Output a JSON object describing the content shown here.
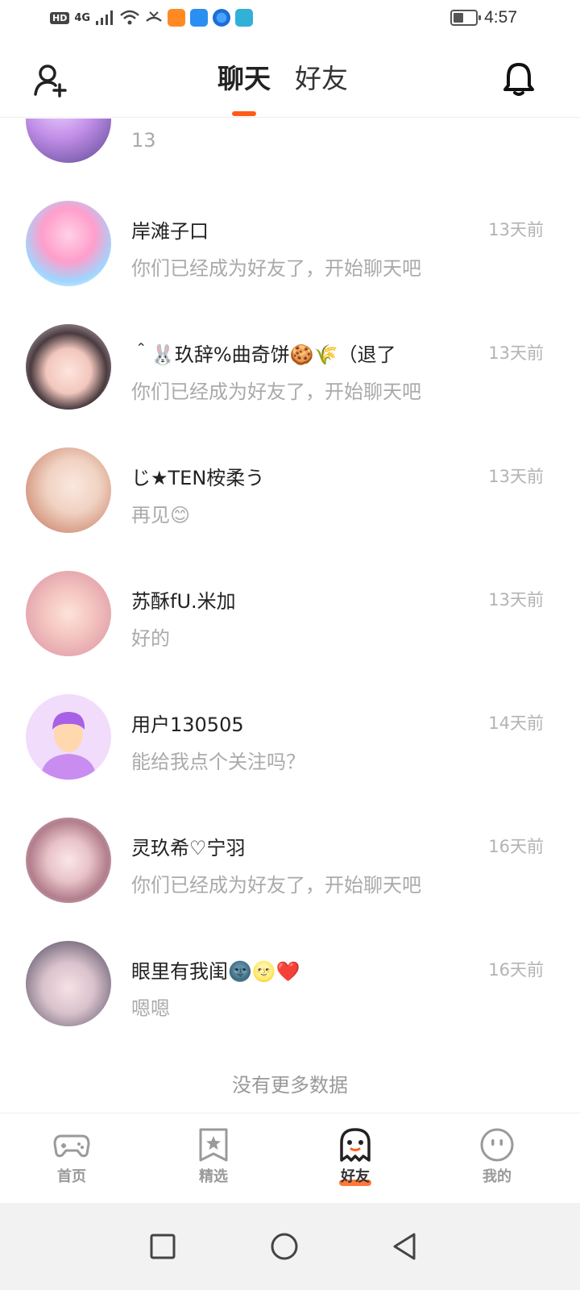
{
  "status_bar": {
    "hd": "HD",
    "signal": "4G",
    "time": "4:57"
  },
  "header": {
    "tabs": [
      {
        "label": "聊天",
        "active": true
      },
      {
        "label": "好友",
        "active": false
      }
    ],
    "icons": {
      "left": "add-user-icon",
      "right": "bell-icon"
    }
  },
  "chats": [
    {
      "name": "",
      "message": "13",
      "time": ""
    },
    {
      "name": "岸滩子口",
      "message": "你们已经成为好友了，开始聊天吧",
      "time": "13天前"
    },
    {
      "name": "＾🐰玖辞%曲奇饼🍪🌾（退了",
      "message": "你们已经成为好友了，开始聊天吧",
      "time": "13天前"
    },
    {
      "name": "じ★TEN桉柔う",
      "message": "再见😊",
      "time": "13天前"
    },
    {
      "name": "苏酥fU.米加",
      "message": "好的",
      "time": "13天前"
    },
    {
      "name": "用户130505",
      "message": "能给我点个关注吗？",
      "time": "14天前"
    },
    {
      "name": "灵玖希♡宁羽",
      "message": "你们已经成为好友了，开始聊天吧",
      "time": "16天前"
    },
    {
      "name": "眼里有我闺🌚🌝❤️",
      "message": "嗯嗯",
      "time": "16天前"
    }
  ],
  "footer_text": "没有更多数据",
  "bottom_nav": [
    {
      "label": "首页",
      "icon": "gamepad-icon",
      "active": false
    },
    {
      "label": "精选",
      "icon": "star-bookmark-icon",
      "active": false
    },
    {
      "label": "好友",
      "icon": "ghost-icon",
      "active": true
    },
    {
      "label": "我的",
      "icon": "face-icon",
      "active": false
    }
  ],
  "colors": {
    "accent": "#ff5c1a",
    "text_secondary": "#aaaaaa"
  }
}
